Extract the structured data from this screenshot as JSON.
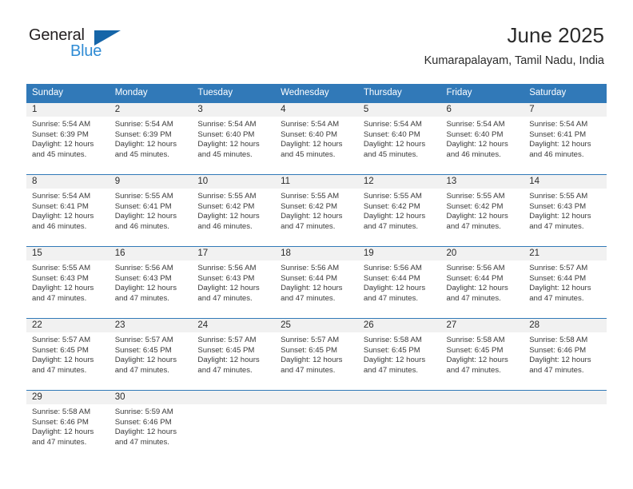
{
  "brand": {
    "name_part1": "General",
    "name_part2": "Blue",
    "logo_icon": "triangle-logo-icon",
    "color_dark": "#231f20",
    "color_blue": "#2e8bd4",
    "color_triangle": "#1565a8"
  },
  "header": {
    "title": "June 2025",
    "subtitle": "Kumarapalayam, Tamil Nadu, India"
  },
  "theme": {
    "header_bg": "#3179b8",
    "header_text": "#ffffff",
    "daynum_bg": "#f1f1f1",
    "cell_text": "#3a3a3a",
    "border": "#3179b8"
  },
  "weekday_headers": [
    "Sunday",
    "Monday",
    "Tuesday",
    "Wednesday",
    "Thursday",
    "Friday",
    "Saturday"
  ],
  "weeks": [
    [
      {
        "day": "1",
        "sunrise": "Sunrise: 5:54 AM",
        "sunset": "Sunset: 6:39 PM",
        "daylight_line1": "Daylight: 12 hours",
        "daylight_line2": "and 45 minutes."
      },
      {
        "day": "2",
        "sunrise": "Sunrise: 5:54 AM",
        "sunset": "Sunset: 6:39 PM",
        "daylight_line1": "Daylight: 12 hours",
        "daylight_line2": "and 45 minutes."
      },
      {
        "day": "3",
        "sunrise": "Sunrise: 5:54 AM",
        "sunset": "Sunset: 6:40 PM",
        "daylight_line1": "Daylight: 12 hours",
        "daylight_line2": "and 45 minutes."
      },
      {
        "day": "4",
        "sunrise": "Sunrise: 5:54 AM",
        "sunset": "Sunset: 6:40 PM",
        "daylight_line1": "Daylight: 12 hours",
        "daylight_line2": "and 45 minutes."
      },
      {
        "day": "5",
        "sunrise": "Sunrise: 5:54 AM",
        "sunset": "Sunset: 6:40 PM",
        "daylight_line1": "Daylight: 12 hours",
        "daylight_line2": "and 45 minutes."
      },
      {
        "day": "6",
        "sunrise": "Sunrise: 5:54 AM",
        "sunset": "Sunset: 6:40 PM",
        "daylight_line1": "Daylight: 12 hours",
        "daylight_line2": "and 46 minutes."
      },
      {
        "day": "7",
        "sunrise": "Sunrise: 5:54 AM",
        "sunset": "Sunset: 6:41 PM",
        "daylight_line1": "Daylight: 12 hours",
        "daylight_line2": "and 46 minutes."
      }
    ],
    [
      {
        "day": "8",
        "sunrise": "Sunrise: 5:54 AM",
        "sunset": "Sunset: 6:41 PM",
        "daylight_line1": "Daylight: 12 hours",
        "daylight_line2": "and 46 minutes."
      },
      {
        "day": "9",
        "sunrise": "Sunrise: 5:55 AM",
        "sunset": "Sunset: 6:41 PM",
        "daylight_line1": "Daylight: 12 hours",
        "daylight_line2": "and 46 minutes."
      },
      {
        "day": "10",
        "sunrise": "Sunrise: 5:55 AM",
        "sunset": "Sunset: 6:42 PM",
        "daylight_line1": "Daylight: 12 hours",
        "daylight_line2": "and 46 minutes."
      },
      {
        "day": "11",
        "sunrise": "Sunrise: 5:55 AM",
        "sunset": "Sunset: 6:42 PM",
        "daylight_line1": "Daylight: 12 hours",
        "daylight_line2": "and 47 minutes."
      },
      {
        "day": "12",
        "sunrise": "Sunrise: 5:55 AM",
        "sunset": "Sunset: 6:42 PM",
        "daylight_line1": "Daylight: 12 hours",
        "daylight_line2": "and 47 minutes."
      },
      {
        "day": "13",
        "sunrise": "Sunrise: 5:55 AM",
        "sunset": "Sunset: 6:42 PM",
        "daylight_line1": "Daylight: 12 hours",
        "daylight_line2": "and 47 minutes."
      },
      {
        "day": "14",
        "sunrise": "Sunrise: 5:55 AM",
        "sunset": "Sunset: 6:43 PM",
        "daylight_line1": "Daylight: 12 hours",
        "daylight_line2": "and 47 minutes."
      }
    ],
    [
      {
        "day": "15",
        "sunrise": "Sunrise: 5:55 AM",
        "sunset": "Sunset: 6:43 PM",
        "daylight_line1": "Daylight: 12 hours",
        "daylight_line2": "and 47 minutes."
      },
      {
        "day": "16",
        "sunrise": "Sunrise: 5:56 AM",
        "sunset": "Sunset: 6:43 PM",
        "daylight_line1": "Daylight: 12 hours",
        "daylight_line2": "and 47 minutes."
      },
      {
        "day": "17",
        "sunrise": "Sunrise: 5:56 AM",
        "sunset": "Sunset: 6:43 PM",
        "daylight_line1": "Daylight: 12 hours",
        "daylight_line2": "and 47 minutes."
      },
      {
        "day": "18",
        "sunrise": "Sunrise: 5:56 AM",
        "sunset": "Sunset: 6:44 PM",
        "daylight_line1": "Daylight: 12 hours",
        "daylight_line2": "and 47 minutes."
      },
      {
        "day": "19",
        "sunrise": "Sunrise: 5:56 AM",
        "sunset": "Sunset: 6:44 PM",
        "daylight_line1": "Daylight: 12 hours",
        "daylight_line2": "and 47 minutes."
      },
      {
        "day": "20",
        "sunrise": "Sunrise: 5:56 AM",
        "sunset": "Sunset: 6:44 PM",
        "daylight_line1": "Daylight: 12 hours",
        "daylight_line2": "and 47 minutes."
      },
      {
        "day": "21",
        "sunrise": "Sunrise: 5:57 AM",
        "sunset": "Sunset: 6:44 PM",
        "daylight_line1": "Daylight: 12 hours",
        "daylight_line2": "and 47 minutes."
      }
    ],
    [
      {
        "day": "22",
        "sunrise": "Sunrise: 5:57 AM",
        "sunset": "Sunset: 6:45 PM",
        "daylight_line1": "Daylight: 12 hours",
        "daylight_line2": "and 47 minutes."
      },
      {
        "day": "23",
        "sunrise": "Sunrise: 5:57 AM",
        "sunset": "Sunset: 6:45 PM",
        "daylight_line1": "Daylight: 12 hours",
        "daylight_line2": "and 47 minutes."
      },
      {
        "day": "24",
        "sunrise": "Sunrise: 5:57 AM",
        "sunset": "Sunset: 6:45 PM",
        "daylight_line1": "Daylight: 12 hours",
        "daylight_line2": "and 47 minutes."
      },
      {
        "day": "25",
        "sunrise": "Sunrise: 5:57 AM",
        "sunset": "Sunset: 6:45 PM",
        "daylight_line1": "Daylight: 12 hours",
        "daylight_line2": "and 47 minutes."
      },
      {
        "day": "26",
        "sunrise": "Sunrise: 5:58 AM",
        "sunset": "Sunset: 6:45 PM",
        "daylight_line1": "Daylight: 12 hours",
        "daylight_line2": "and 47 minutes."
      },
      {
        "day": "27",
        "sunrise": "Sunrise: 5:58 AM",
        "sunset": "Sunset: 6:45 PM",
        "daylight_line1": "Daylight: 12 hours",
        "daylight_line2": "and 47 minutes."
      },
      {
        "day": "28",
        "sunrise": "Sunrise: 5:58 AM",
        "sunset": "Sunset: 6:46 PM",
        "daylight_line1": "Daylight: 12 hours",
        "daylight_line2": "and 47 minutes."
      }
    ],
    [
      {
        "day": "29",
        "sunrise": "Sunrise: 5:58 AM",
        "sunset": "Sunset: 6:46 PM",
        "daylight_line1": "Daylight: 12 hours",
        "daylight_line2": "and 47 minutes."
      },
      {
        "day": "30",
        "sunrise": "Sunrise: 5:59 AM",
        "sunset": "Sunset: 6:46 PM",
        "daylight_line1": "Daylight: 12 hours",
        "daylight_line2": "and 47 minutes."
      },
      {
        "day": "",
        "sunrise": "",
        "sunset": "",
        "daylight_line1": "",
        "daylight_line2": ""
      },
      {
        "day": "",
        "sunrise": "",
        "sunset": "",
        "daylight_line1": "",
        "daylight_line2": ""
      },
      {
        "day": "",
        "sunrise": "",
        "sunset": "",
        "daylight_line1": "",
        "daylight_line2": ""
      },
      {
        "day": "",
        "sunrise": "",
        "sunset": "",
        "daylight_line1": "",
        "daylight_line2": ""
      },
      {
        "day": "",
        "sunrise": "",
        "sunset": "",
        "daylight_line1": "",
        "daylight_line2": ""
      }
    ]
  ]
}
